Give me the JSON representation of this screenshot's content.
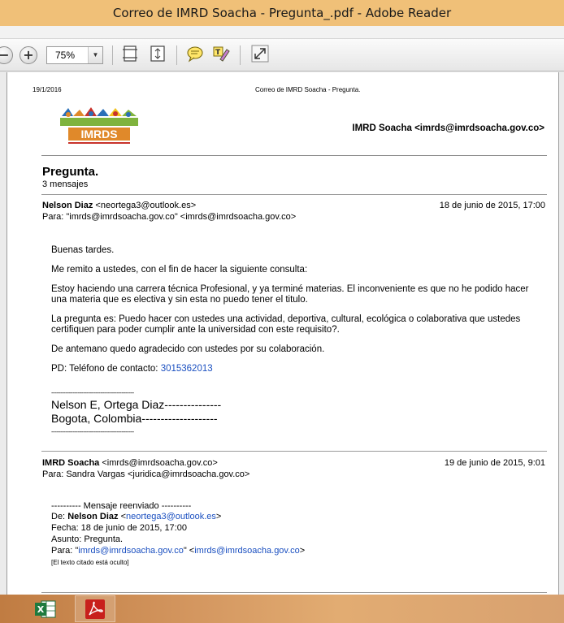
{
  "window": {
    "title": "Correo de IMRD Soacha - Pregunta_.pdf - Adobe Reader"
  },
  "toolbar": {
    "zoom_value": "75%"
  },
  "page": {
    "header_date": "19/1/2016",
    "header_title": "Correo de IMRD Soacha - Pregunta.",
    "imrd_address": "IMRD Soacha <imrds@imrdsoacha.gov.co>",
    "logo_text": "IMRDS",
    "subject": "Pregunta.",
    "message_count": "3 mensajes"
  },
  "message1": {
    "from_name": "Nelson Diaz",
    "from_email": "<neortega3@outlook.es>",
    "date": "18 de junio de 2015, 17:00",
    "to": "Para: \"imrds@imrdsoacha.gov.co\" <imrds@imrdsoacha.gov.co>",
    "greeting": "Buenas tardes.",
    "para1": "Me remito a ustedes, con el fin de hacer la siguiente consulta:",
    "para2": "Estoy haciendo una carrera técnica Profesional, y ya terminé materias. El inconveniente es que no he podido hacer una materia que es electiva y sin esta  no puedo tener el titulo.",
    "para3": "La pregunta es: Puedo hacer con ustedes una actividad, deportiva, cultural, ecológica  o colaborativa que ustedes certifiquen para poder cumplir ante la universidad con este requisito?.",
    "para4": "De antemano quedo agradecido con ustedes por su colaboración.",
    "phone_label": "PD: Teléfono de contacto: ",
    "phone": "3015362013",
    "dash_line": "-----------------------------------------------",
    "sig_name": "Nelson E, Ortega Diaz---------------",
    "sig_city": "Bogota, Colombia--------------------",
    "dash_line2": "-----------------------------------------------"
  },
  "message2": {
    "from_name": "IMRD Soacha",
    "from_email": "<imrds@imrdsoacha.gov.co>",
    "date": "19 de junio de 2015, 9:01",
    "to": "Para: Sandra Vargas <juridica@imrdsoacha.gov.co>",
    "fw_header": "---------- Mensaje reenviado ----------",
    "fw_from_label": "De: ",
    "fw_from_name": "Nelson Diaz",
    "fw_from_pre": " <",
    "fw_from_email": "neortega3@outlook.es",
    "fw_from_post": ">",
    "fw_date": "Fecha: 18 de junio de 2015, 17:00",
    "fw_subject": "Asunto: Pregunta.",
    "fw_to_label": "Para: \"",
    "fw_to_link1": "imrds@imrdsoacha.gov.co",
    "fw_to_mid": "\" <",
    "fw_to_link2": "imrds@imrdsoacha.gov.co",
    "fw_to_end": ">",
    "hidden_text": "[El texto citado está oculto]"
  },
  "taskbar": {
    "items": [
      "Excel",
      "Adobe Reader"
    ]
  },
  "colors": {
    "title_bar": "#f0c078",
    "link": "#1a4fc0",
    "taskbar": "#d49760"
  }
}
